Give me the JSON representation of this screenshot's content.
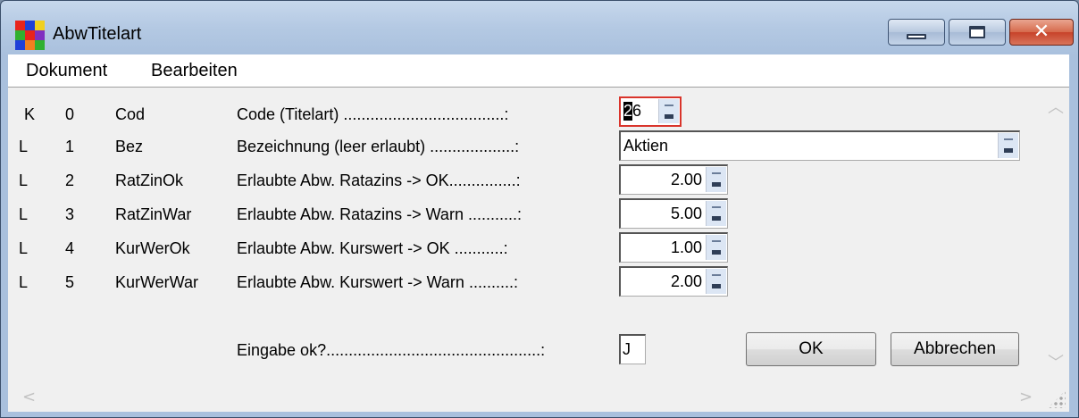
{
  "window": {
    "title": "AbwTitelart",
    "close_glyph": "✕"
  },
  "menu": [
    "Dokument",
    "Bearbeiten"
  ],
  "rows": [
    {
      "flag": "K",
      "index": "0",
      "short": "Cod",
      "label": "Code (Titelart)",
      "value": "26",
      "cursor_char": "2",
      "rest": "6"
    },
    {
      "flag": "L",
      "index": "1",
      "short": "Bez",
      "label": "Bezeichnung (leer erlaubt)",
      "value": "Aktien"
    },
    {
      "flag": "L",
      "index": "2",
      "short": "RatZinOk",
      "label": "Erlaubte Abw. Ratazins -> OK",
      "value": "2.00"
    },
    {
      "flag": "L",
      "index": "3",
      "short": "RatZinWar",
      "label": "Erlaubte Abw. Ratazins -> Warn",
      "value": "5.00"
    },
    {
      "flag": "L",
      "index": "4",
      "short": "KurWerOk",
      "label": "Erlaubte Abw. Kurswert -> OK",
      "value": "1.00"
    },
    {
      "flag": "L",
      "index": "5",
      "short": "KurWerWar",
      "label": "Erlaubte Abw. Kurswert -> Warn",
      "value": "2.00"
    }
  ],
  "confirm": {
    "label": "Eingabe ok?",
    "value": "J"
  },
  "buttons": {
    "ok": "OK",
    "cancel": "Abbrechen"
  },
  "scroll_glyphs": {
    "up": "︿",
    "down": "﹀",
    "left": "<",
    "right": ">"
  },
  "colors": {
    "titlebar": "#b4c9e3",
    "close_button": "#c7432a",
    "focus_border": "#d9342b"
  }
}
